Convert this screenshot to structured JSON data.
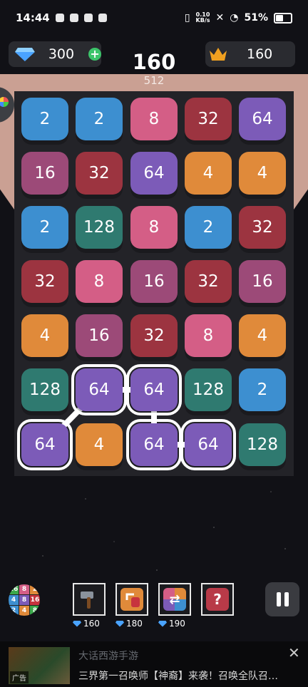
{
  "status_bar": {
    "time": "14:44",
    "net_speed_value": "0.10",
    "net_speed_unit": "KB/s",
    "battery": "51%"
  },
  "header": {
    "gems": "300",
    "best": "160",
    "score": "160",
    "target": "512"
  },
  "board": {
    "rows": [
      [
        "2",
        "2",
        "8",
        "32",
        "64"
      ],
      [
        "16",
        "32",
        "64",
        "4",
        "4"
      ],
      [
        "2",
        "128",
        "8",
        "2",
        "32"
      ],
      [
        "32",
        "8",
        "16",
        "32",
        "16"
      ],
      [
        "4",
        "16",
        "32",
        "8",
        "4"
      ],
      [
        "128",
        "64",
        "64",
        "128",
        "2"
      ],
      [
        "64",
        "4",
        "64",
        "64",
        "128"
      ]
    ],
    "selected_path": [
      [
        6,
        0
      ],
      [
        5,
        1
      ],
      [
        5,
        2
      ],
      [
        6,
        2
      ],
      [
        6,
        3
      ]
    ]
  },
  "tile_colors": {
    "2": "#3d8fd0",
    "4": "#e08a3a",
    "8": "#d45e86",
    "16": "#9c4a78",
    "32": "#9c3440",
    "64": "#7c5bb8",
    "128": "#2f7a70"
  },
  "powerups": [
    {
      "name": "hammer",
      "cost": "160"
    },
    {
      "name": "swap",
      "cost": "180"
    },
    {
      "name": "shuffle",
      "cost": "190"
    },
    {
      "name": "mystery",
      "label": "?"
    }
  ],
  "mini_board": [
    "16",
    "8",
    "2",
    "4",
    "8",
    "16",
    "2",
    "4",
    "8"
  ],
  "ad": {
    "title": "大话西游手游",
    "text": "三界第一召唤师【神裔】来袭！召唤全队召…",
    "tag": "广告",
    "close": "✕"
  }
}
